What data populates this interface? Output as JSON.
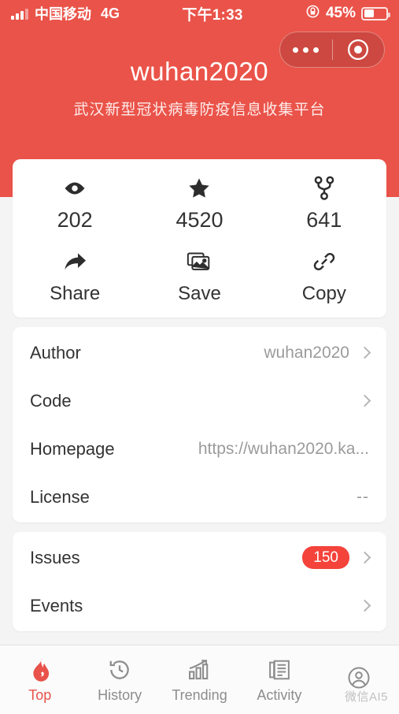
{
  "statusbar": {
    "carrier": "中国移动",
    "network": "4G",
    "time": "下午1:33",
    "battery_percent": "45%",
    "lock_icon": "lock-icon",
    "signal_icon": "signal-bars-icon",
    "battery_icon": "battery-icon"
  },
  "capsule": {
    "more_icon": "more-dots-icon",
    "close_icon": "target-circle-icon"
  },
  "header": {
    "title": "wuhan2020",
    "subtitle": "武汉新型冠状病毒防疫信息收集平台",
    "background_color": "#ea5349"
  },
  "stats": [
    {
      "icon": "eye-icon",
      "value": "202",
      "name": "watchers"
    },
    {
      "icon": "star-icon",
      "value": "4520",
      "name": "stars"
    },
    {
      "icon": "fork-icon",
      "value": "641",
      "name": "forks"
    }
  ],
  "actions": [
    {
      "icon": "share-arrow-icon",
      "label": "Share"
    },
    {
      "icon": "image-stack-icon",
      "label": "Save"
    },
    {
      "icon": "link-chain-icon",
      "label": "Copy"
    }
  ],
  "info_rows": [
    {
      "label": "Author",
      "value": "wuhan2020",
      "chevron": true,
      "badge": null
    },
    {
      "label": "Code",
      "value": "",
      "chevron": true,
      "badge": null
    },
    {
      "label": "Homepage",
      "value": "https://wuhan2020.ka...",
      "chevron": false,
      "badge": null
    },
    {
      "label": "License",
      "value": "--",
      "chevron": false,
      "badge": null
    }
  ],
  "link_rows": [
    {
      "label": "Issues",
      "badge": "150",
      "chevron": true
    },
    {
      "label": "Events",
      "badge": null,
      "chevron": true
    }
  ],
  "tabs": [
    {
      "label": "Top",
      "icon": "flame-icon",
      "active": true
    },
    {
      "label": "History",
      "icon": "history-icon",
      "active": false
    },
    {
      "label": "Trending",
      "icon": "bar-chart-trending-icon",
      "active": false
    },
    {
      "label": "Activity",
      "icon": "document-lines-icon",
      "active": false
    },
    {
      "label": "",
      "icon": "user-circle-icon",
      "active": false
    }
  ],
  "watermark": "微信AI5",
  "colors": {
    "accent": "#ea5349",
    "badge": "#f4433b",
    "page_bg": "#f4f4f4"
  }
}
